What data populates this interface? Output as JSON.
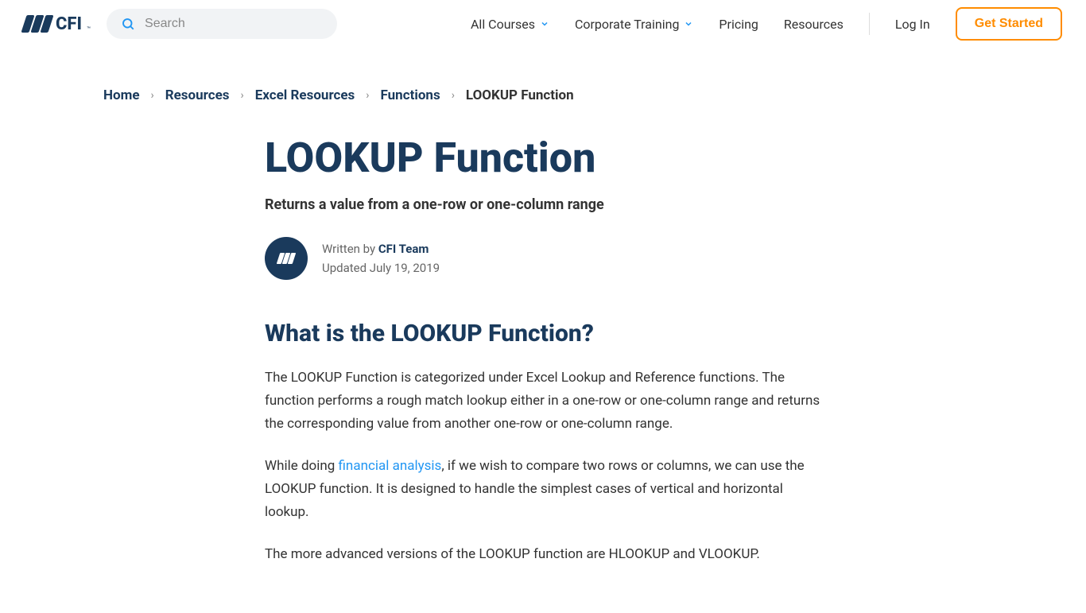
{
  "header": {
    "logo_text": "CFI",
    "search_placeholder": "Search",
    "nav": {
      "all_courses": "All Courses",
      "corporate_training": "Corporate Training",
      "pricing": "Pricing",
      "resources": "Resources"
    },
    "login": "Log In",
    "get_started": "Get Started"
  },
  "breadcrumb": {
    "items": [
      "Home",
      "Resources",
      "Excel Resources",
      "Functions"
    ],
    "current": "LOOKUP Function"
  },
  "article": {
    "title": "LOOKUP Function",
    "subtitle": "Returns a value from a one-row or one-column range",
    "written_by_label": "Written by ",
    "author": "CFI Team",
    "updated": "Updated July 19, 2019",
    "heading1": "What is the LOOKUP Function?",
    "para1": "The LOOKUP Function is categorized under Excel Lookup and Reference functions. The function performs a rough match lookup either in a one-row or one-column range and returns the corresponding value from another one-row or one-column range.",
    "para2_a": "While doing ",
    "para2_link": "financial analysis",
    "para2_b": ", if we wish to compare two rows or columns, we can use the LOOKUP function. It is designed to handle the simplest cases of vertical and horizontal lookup.",
    "para3": "The more advanced versions of the LOOKUP function are HLOOKUP and VLOOKUP."
  }
}
